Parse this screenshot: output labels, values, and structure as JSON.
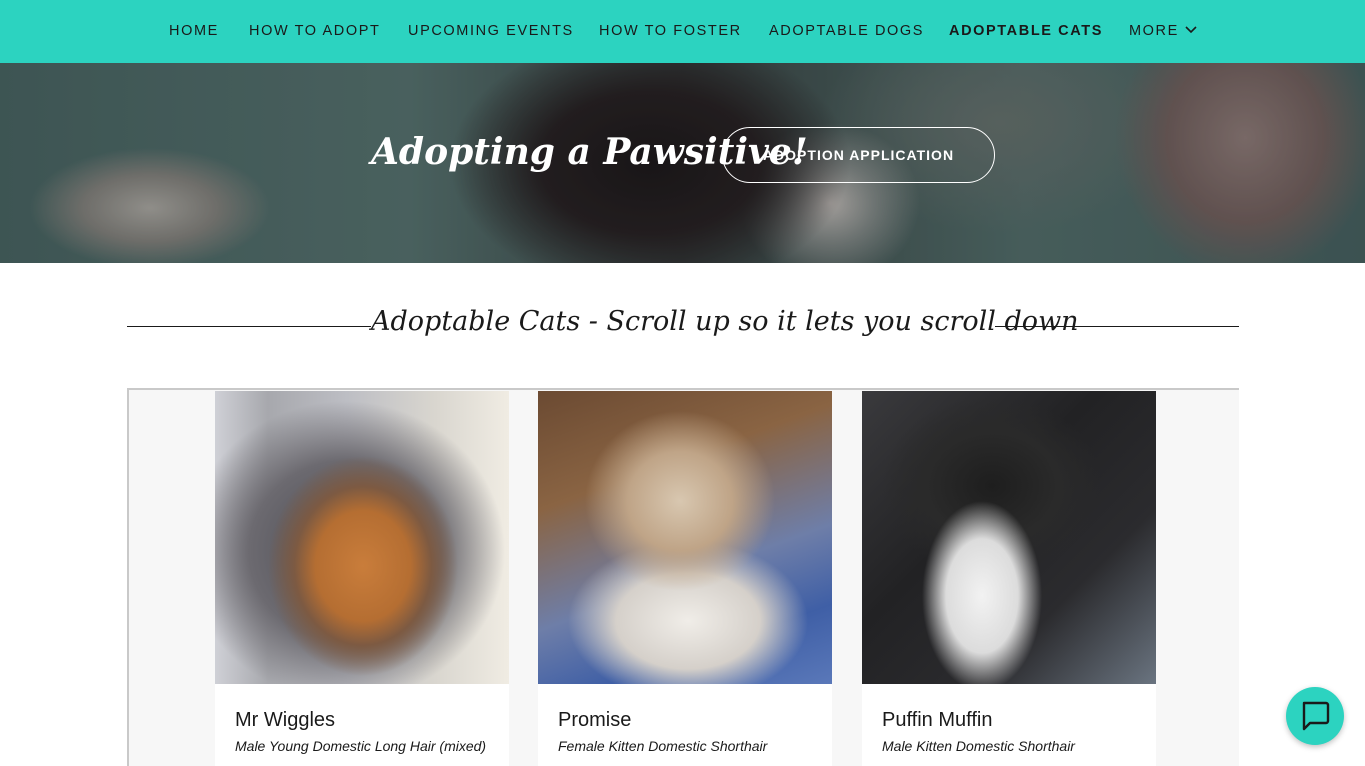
{
  "nav": {
    "items": [
      {
        "label": "HOME",
        "active": false
      },
      {
        "label": "HOW TO ADOPT",
        "active": false
      },
      {
        "label": "UPCOMING EVENTS",
        "active": false
      },
      {
        "label": "HOW TO FOSTER",
        "active": false
      },
      {
        "label": "ADOPTABLE DOGS",
        "active": false
      },
      {
        "label": "ADOPTABLE CATS",
        "active": true
      }
    ],
    "more_label": "MORE",
    "more_icon": "chevron-down-icon",
    "background_color": "#2cd3c0"
  },
  "hero": {
    "title": "Adopting a Pawsitive!",
    "button_label": "ADOPTION APPLICATION"
  },
  "section": {
    "title": "Adoptable Cats - Scroll up so it lets you scroll down"
  },
  "cats": [
    {
      "name": "Mr Wiggles",
      "description": "Male Young Domestic Long Hair (mixed)"
    },
    {
      "name": "Promise",
      "description": "Female Kitten Domestic Shorthair"
    },
    {
      "name": "Puffin Muffin",
      "description": "Male Kitten Domestic Shorthair"
    }
  ],
  "chat": {
    "icon": "chat-bubble-icon",
    "color": "#2cd3c0"
  }
}
